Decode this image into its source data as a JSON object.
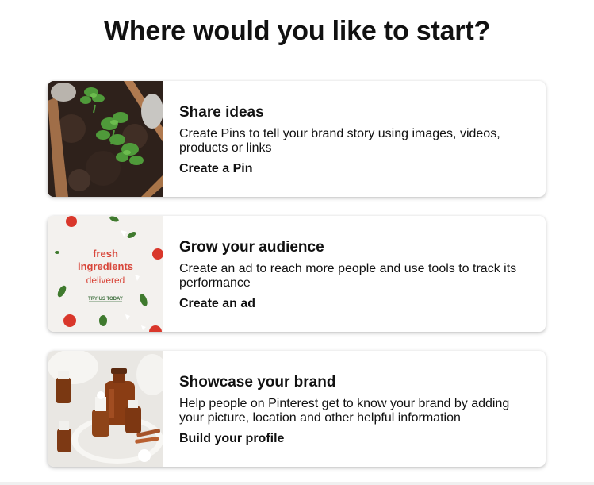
{
  "header": {
    "title": "Where would you like to start?"
  },
  "cards": [
    {
      "title": "Share ideas",
      "description": "Create Pins to tell your brand story using images, videos, products or links",
      "action": "Create a Pin",
      "image": "garden-planter-photo"
    },
    {
      "title": "Grow your audience",
      "description": "Create an ad to reach more people and use tools to track its performance",
      "action": "Create an ad",
      "image": "fresh-ingredients-ad-photo",
      "image_text": {
        "line1": "fresh",
        "line2": "ingredients",
        "line3": "delivered",
        "cta": "TRY US TODAY"
      }
    },
    {
      "title": "Showcase your brand",
      "description": "Help people on Pinterest get to know your brand by adding your picture, location and other helpful information",
      "action": "Build your profile",
      "image": "amber-bottles-photo"
    }
  ],
  "colors": {
    "text": "#111111",
    "ad_text_red": "#d8463a",
    "ad_cta_green": "#3c6e3c"
  }
}
